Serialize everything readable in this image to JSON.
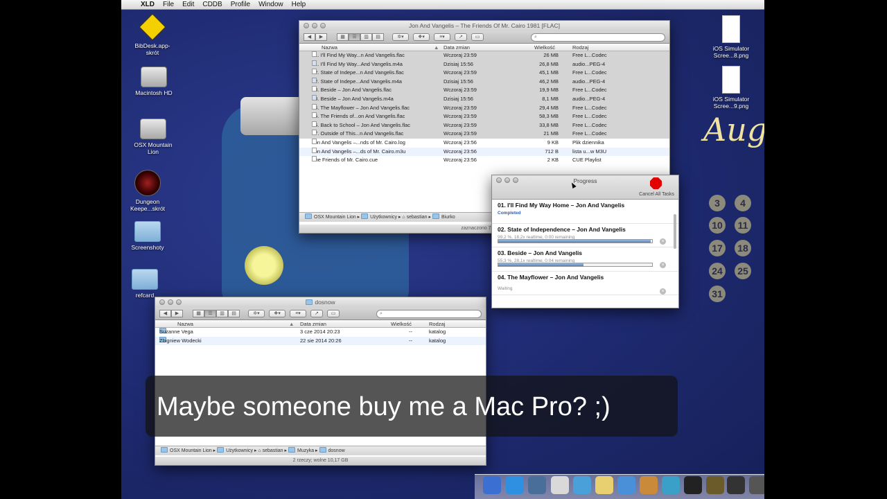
{
  "menubar": {
    "app": "XLD",
    "items": [
      "File",
      "Edit",
      "CDDB",
      "Profile",
      "Window",
      "Help"
    ]
  },
  "desktop_icons": [
    {
      "label": "BibDesk.app-\nskrót",
      "icon": "bibdesk-icon"
    },
    {
      "label": "Macintosh HD",
      "icon": "hard-drive-icon"
    },
    {
      "label": "OSX Mountain\nLion",
      "icon": "hard-drive-icon"
    },
    {
      "label": "Dungeon\nKeepe...skrót",
      "icon": "dungeon-keeper-icon"
    },
    {
      "label": "Screenshoty",
      "icon": "folder-icon"
    },
    {
      "label": "refcard",
      "icon": "folder-icon"
    },
    {
      "label": "iOS Simulator\nScree...8.png",
      "icon": "document-icon"
    },
    {
      "label": "iOS Simulator\nScree...9.png",
      "icon": "document-icon"
    }
  ],
  "calendar": {
    "title": "Aug",
    "days": [
      "3",
      "4",
      "10",
      "11",
      "17",
      "18",
      "24",
      "25",
      "31"
    ]
  },
  "finder_top": {
    "title": "Jon And Vangelis – The Friends Of Mr. Cairo 1981 [FLAC]",
    "columns": {
      "name": "Nazwa",
      "date": "Data zmian",
      "size": "Wielkość",
      "kind": "Rodzaj"
    },
    "rows": [
      {
        "name": "01. I'll Find My Way...n And Vangelis.flac",
        "date": "Wczoraj 23:59",
        "size": "26 MB",
        "kind": "Free L...Codec",
        "type": "flac"
      },
      {
        "name": "01. I'll Find My Way...And Vangelis.m4a",
        "date": "Dzisiaj 15:56",
        "size": "26,8 MB",
        "kind": "audio...PEG-4",
        "type": "m4a"
      },
      {
        "name": "02. State of Indepe...n And Vangelis.flac",
        "date": "Wczoraj 23:59",
        "size": "45,1 MB",
        "kind": "Free L...Codec",
        "type": "flac"
      },
      {
        "name": "02. State of Indepe...And Vangelis.m4a",
        "date": "Dzisiaj 15:56",
        "size": "46,2 MB",
        "kind": "audio...PEG-4",
        "type": "m4a"
      },
      {
        "name": "03. Beside – Jon And Vangelis.flac",
        "date": "Wczoraj 23:59",
        "size": "19,9 MB",
        "kind": "Free L...Codec",
        "type": "flac"
      },
      {
        "name": "03. Beside – Jon And Vangelis.m4a",
        "date": "Dzisiaj 15:56",
        "size": "8,1 MB",
        "kind": "audio...PEG-4",
        "type": "m4a"
      },
      {
        "name": "04. The Mayflower – Jon And Vangelis.flac",
        "date": "Wczoraj 23:59",
        "size": "29,4 MB",
        "kind": "Free L...Codec",
        "type": "flac"
      },
      {
        "name": "05. The Friends of...on And Vangelis.flac",
        "date": "Wczoraj 23:59",
        "size": "58,3 MB",
        "kind": "Free L...Codec",
        "type": "flac"
      },
      {
        "name": "06. Back to School – Jon And Vangelis.flac",
        "date": "Wczoraj 23:59",
        "size": "33,8 MB",
        "kind": "Free L...Codec",
        "type": "flac"
      },
      {
        "name": "07. Outside of This...n And Vangelis.flac",
        "date": "Wczoraj 23:59",
        "size": "21 MB",
        "kind": "Free L...Codec",
        "type": "flac"
      },
      {
        "name": "Jon And Vangelis –...nds of Mr. Cairo.log",
        "date": "Wczoraj 23:56",
        "size": "9 KB",
        "kind": "Plik dziennika",
        "type": "doc"
      },
      {
        "name": "Jon And Vangelis –...ds of Mr. Cairo.m3u",
        "date": "Wczoraj 23:56",
        "size": "712 B",
        "kind": "lista u...w M3U",
        "type": "doc"
      },
      {
        "name": "The Friends of Mr. Cairo.cue",
        "date": "Wczoraj 23:56",
        "size": "2 KB",
        "kind": "CUE Playlist",
        "type": "doc"
      }
    ],
    "path": [
      "OSX Mountain Lion",
      "Użytkownicy",
      "sebastian",
      "Biurko"
    ],
    "status": "zaznaczono 7 z 13; w"
  },
  "finder_bottom": {
    "title": "dosnow",
    "columns": {
      "name": "Nazwa",
      "date": "Data zmian",
      "size": "Wielkość",
      "kind": "Rodzaj"
    },
    "rows": [
      {
        "name": "Suzanne Vega",
        "date": "3 cze 2014 20:23",
        "size": "--",
        "kind": "katalog"
      },
      {
        "name": "Zbigniew Wodecki",
        "date": "22 sie 2014 20:26",
        "size": "--",
        "kind": "katalog"
      }
    ],
    "path": [
      "OSX Mountain Lion",
      "Użytkownicy",
      "sebastian",
      "Muzyka",
      "dosnow"
    ],
    "status": "2 rzeczy; wolne 10,17 GB"
  },
  "progress": {
    "title": "Progress",
    "cancel_all": "Cancel All Tasks",
    "tasks": [
      {
        "title": "01. I'll Find My Way Home – Jon And Vangelis",
        "status": "Completed",
        "progress": null
      },
      {
        "title": "02. State of Independence – Jon And Vangelis",
        "status": "99,2 %, 18,2x realtime, 0:00 remaining",
        "progress": 0.992
      },
      {
        "title": "03. Beside – Jon And Vangelis",
        "status": "55,3 %, 28,1x realtime, 0:04 remaining",
        "progress": 0.553
      },
      {
        "title": "04. The Mayflower – Jon And Vangelis",
        "status": "Waiting",
        "progress": null
      }
    ]
  },
  "subtitle": "Maybe someone buy me a Mac Pro? ;)",
  "dock": [
    "finder-icon",
    "safari-icon",
    "xcode-icon",
    "calendar-icon",
    "itunes-icon",
    "notes-icon",
    "pages-icon",
    "coffee-icon",
    "mail-icon",
    "bbedit-icon",
    "xld-icon",
    "kindle-icon",
    "photo-icon",
    "scripts-icon",
    "downloads-icon",
    "h-icon",
    "documents-folder-icon",
    "trash-icon"
  ]
}
